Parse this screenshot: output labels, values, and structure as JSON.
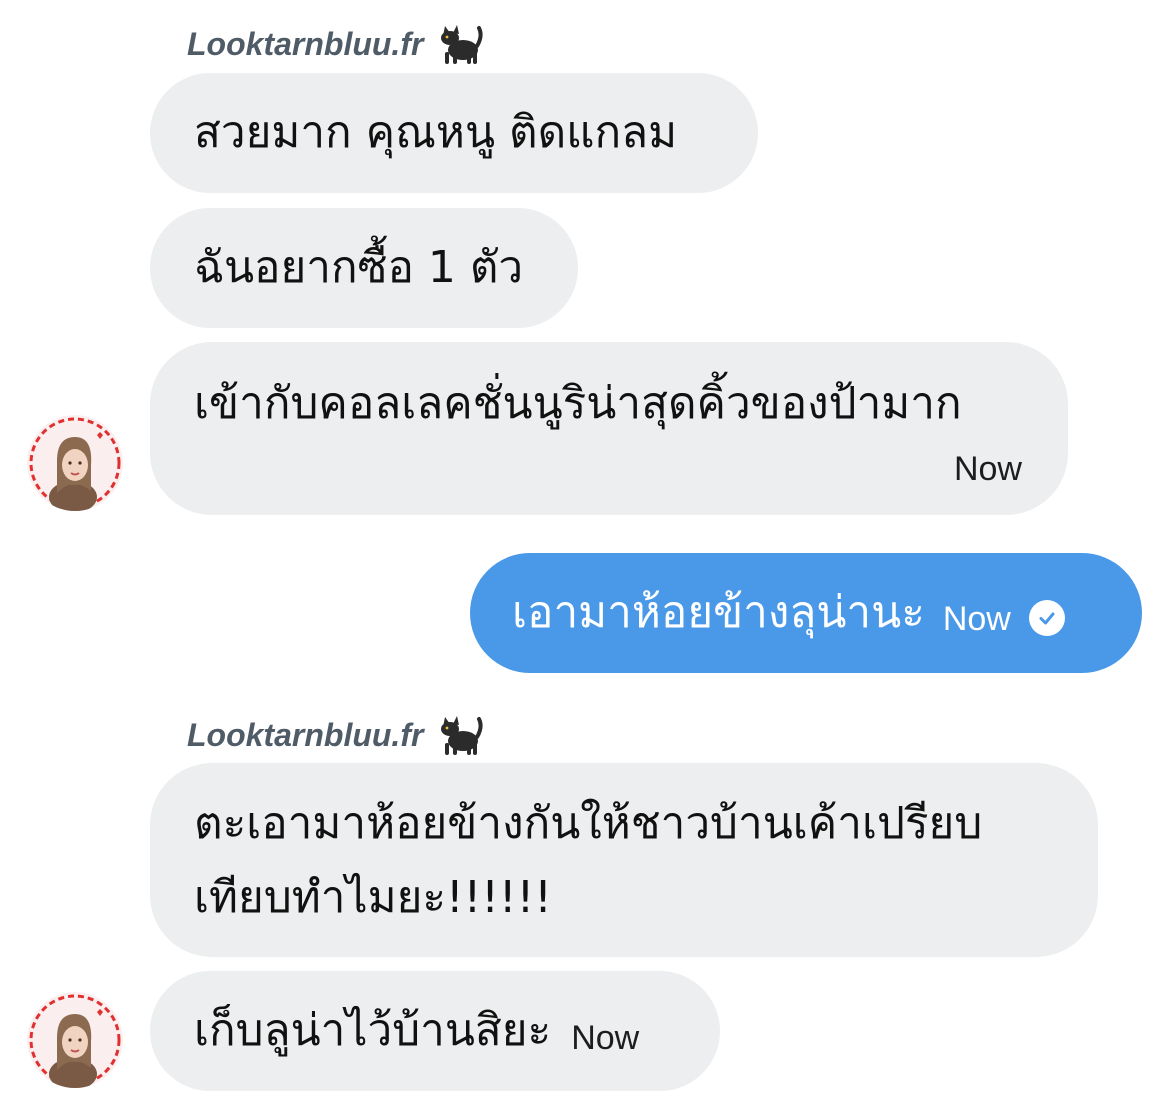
{
  "conversation": {
    "messages": [
      {
        "sender": "Looktarnbluu.fr",
        "text": "สวยมาก คุณหนู ติดแกลม"
      },
      {
        "text": "ฉันอยากซื้อ 1 ตัว"
      },
      {
        "text": "เข้ากับคอลเลคชั่นนูริน่าสุดคิ้วของป้ามาก",
        "time": "Now"
      },
      {
        "text": "เอามาห้อยข้างลุน่านะ",
        "time": "Now",
        "outgoing": true
      },
      {
        "sender": "Looktarnbluu.fr",
        "text_lines": [
          "ตะเอามาห้อยข้างกันให้ชาวบ้านเค้าเปรียบ",
          "เทียบทำไมยะ!!!!!!"
        ]
      },
      {
        "text": "เก็บลูน่าไว้บ้านสิยะ",
        "time": "Now"
      }
    ]
  },
  "icons": {
    "sender_icon": "black-cat-icon",
    "read_receipt": "check-circle-icon",
    "avatar": "contact-avatar"
  },
  "colors": {
    "incoming_bubble": "#eceeef",
    "outgoing_bubble": "#4a99e9",
    "sender_name": "#4f5b66"
  }
}
